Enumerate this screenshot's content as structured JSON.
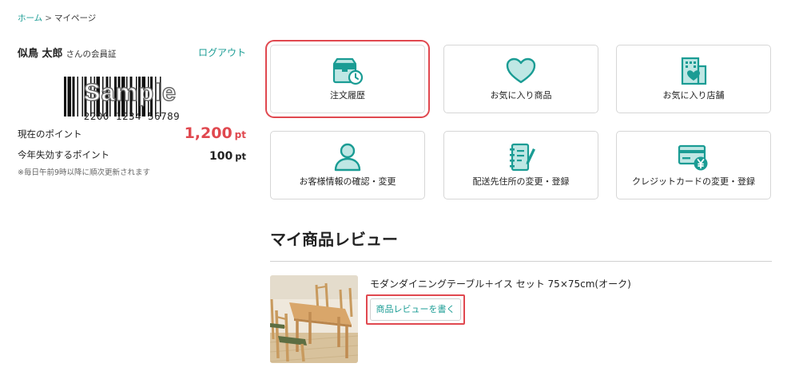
{
  "breadcrumb": {
    "home": "ホーム",
    "separator": ">",
    "current": "マイページ"
  },
  "member": {
    "name": "似鳥 太郎",
    "name_suffix": "さんの会員証",
    "logout_label": "ログアウト",
    "barcode_watermark": "Sample",
    "card_number": "2200 1234 56789",
    "current_points_label": "現在のポイント",
    "current_points_value": "1,200",
    "current_points_unit": "pt",
    "expiring_points_label": "今年失効するポイント",
    "expiring_points_value": "100",
    "expiring_points_unit": "pt",
    "note": "※毎日午前9時以降に順次更新されます"
  },
  "menu": {
    "tiles": [
      {
        "label": "注文履歴",
        "icon": "order-history-icon",
        "highlighted": true
      },
      {
        "label": "お気に入り商品",
        "icon": "heart-icon",
        "highlighted": false
      },
      {
        "label": "お気に入り店舗",
        "icon": "store-icon",
        "highlighted": false
      },
      {
        "label": "お客様情報の確認・変更",
        "icon": "user-icon",
        "highlighted": false
      },
      {
        "label": "配送先住所の変更・登録",
        "icon": "address-book-icon",
        "highlighted": false
      },
      {
        "label": "クレジットカードの変更・登録",
        "icon": "credit-card-yen-icon",
        "highlighted": false
      }
    ]
  },
  "review": {
    "title": "マイ商品レビュー",
    "product_name": "モダンダイニングテーブル＋イス セット 75×75cm(オーク)",
    "button_label": "商品レビューを書く"
  },
  "colors": {
    "accent": "#1a9c94",
    "icon_fill": "#bfe7e4",
    "points_red": "#e0484f",
    "highlight_frame": "#e0484f"
  }
}
